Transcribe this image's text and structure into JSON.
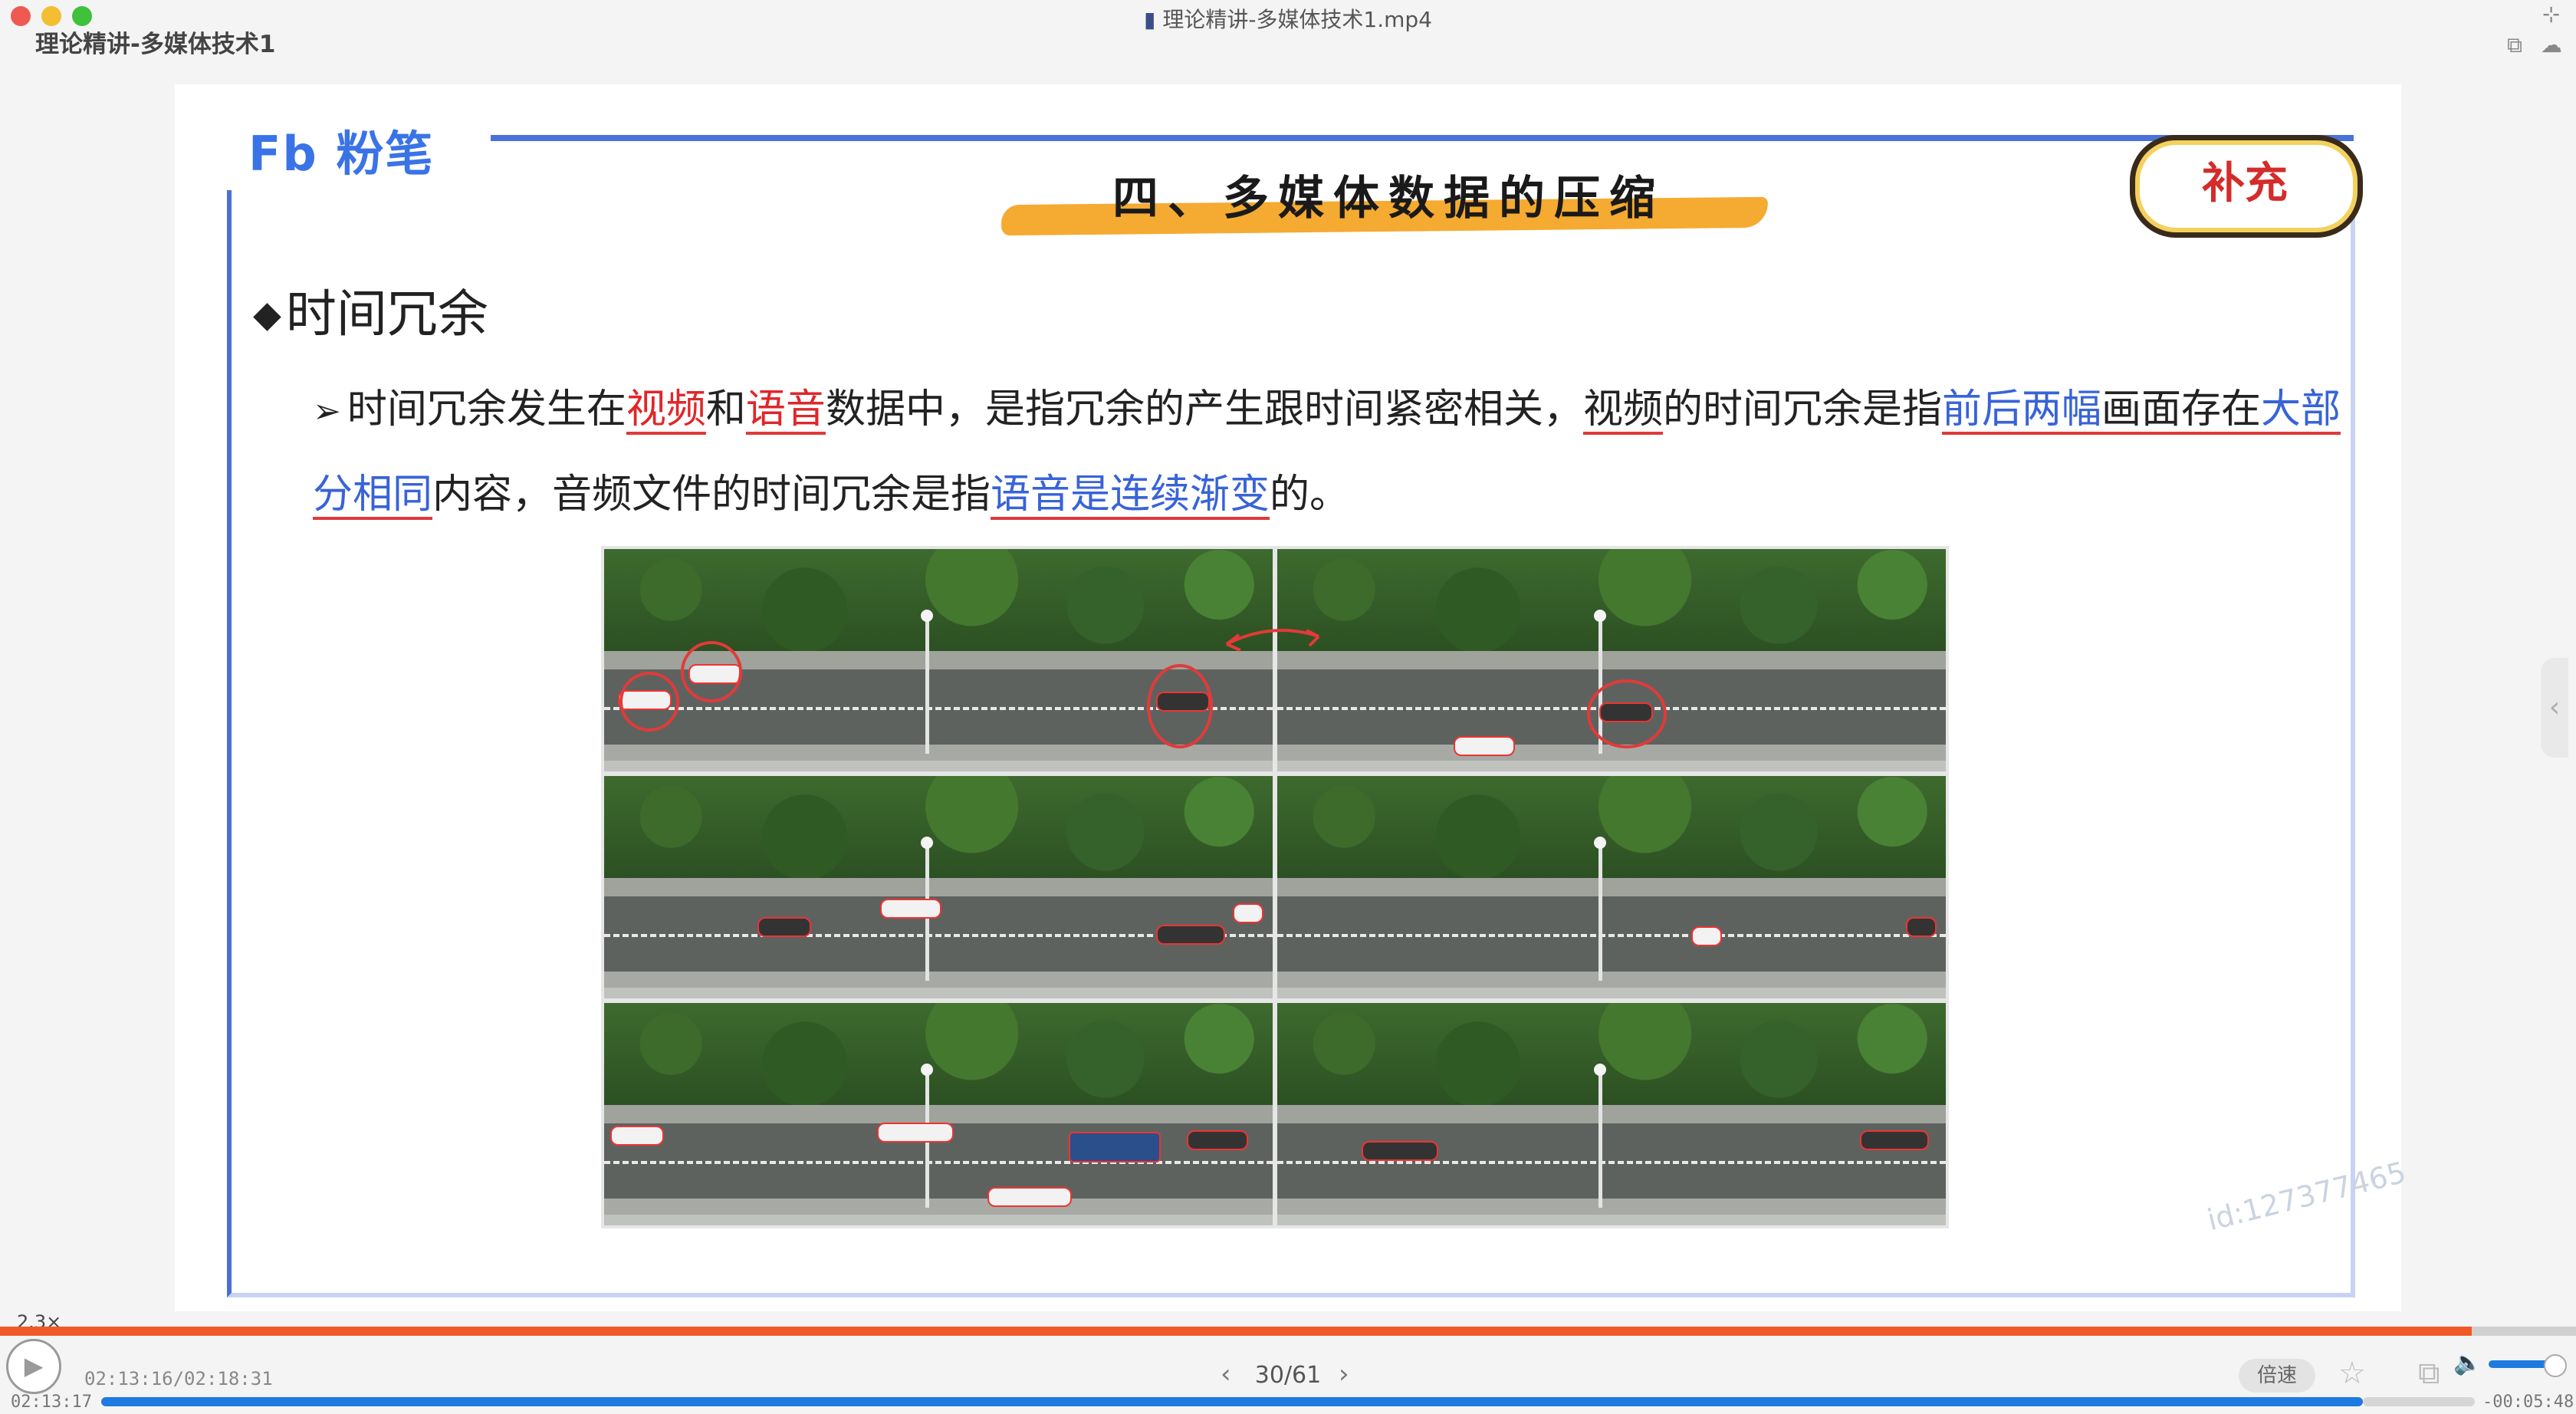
{
  "window": {
    "title": "理论精讲-多媒体技术1.mp4",
    "course_title": "理论精讲-多媒体技术1"
  },
  "slide": {
    "logo": "Fb 粉笔",
    "title": "四、多媒体数据的压缩",
    "badge": "补充",
    "heading": "时间冗余",
    "paragraph": {
      "p1": "时间冗余发生在",
      "p2": "视频",
      "p3": "和",
      "p4": "语音",
      "p5": "数据中，是指冗余的产生跟时间紧密相关，",
      "p6": "视频",
      "p7": "的时间冗余是指",
      "p8": "前后两幅",
      "p9": "画面存在",
      "p10": "大部分相同",
      "p11": "内容，音频文件的时间冗余是指",
      "p12": "语音是连续渐变",
      "p13": "的。"
    },
    "watermark": "id:127377465"
  },
  "player": {
    "speed_tag": "2.3×",
    "time_total": "02:13:16/02:18:31",
    "time_elapsed": "02:13:17",
    "time_remaining": "-00:05:48",
    "page": "30/61",
    "speed_button": "倍速",
    "progress_fraction": 0.96
  },
  "colors": {
    "accent_blue": "#3a73e6",
    "emphasis_red": "#e0262a",
    "emphasis_blue": "#3863d8",
    "progress_orange": "#f05a28",
    "progress_blue": "#1f7ae0"
  }
}
